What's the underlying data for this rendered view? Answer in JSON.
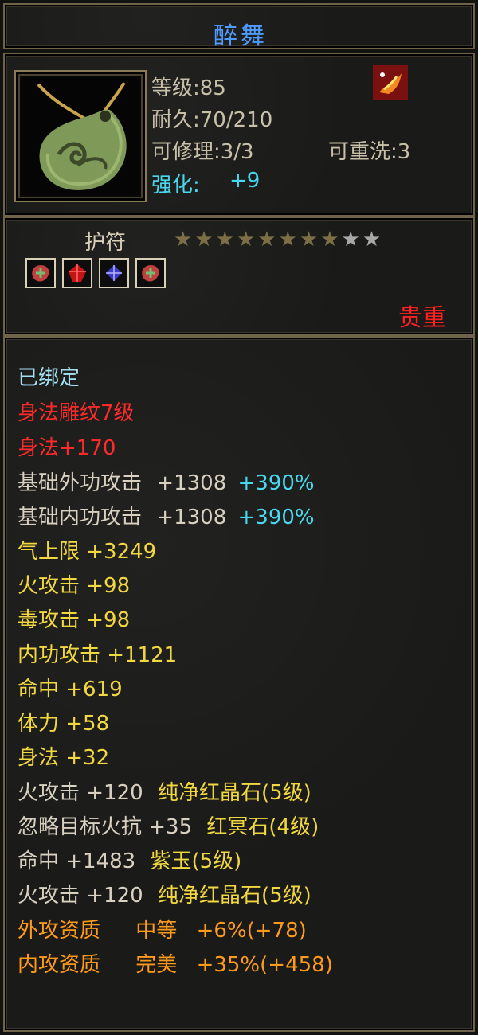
{
  "item": {
    "name": "醉舞",
    "level_label": "等级:85",
    "durability_label": "耐久:70/210",
    "repair_label": "可修理:3/3",
    "rewash_label": "可重洗:3",
    "enhance_prefix": "强化:",
    "enhance_value": "+9",
    "type": "护符",
    "stars_filled": 8,
    "stars_total": 10,
    "rarity": "贵重",
    "gems": [
      "green-gem",
      "red-gem",
      "blue-gem",
      "green-gem"
    ],
    "icon": "jade-pendant-icon",
    "badge_icon": "phoenix-badge-icon"
  },
  "stats": {
    "bound": "已绑定",
    "engrave": "身法雕纹7级",
    "engrave_bonus": "身法+170",
    "base_outer_attack": {
      "label": "基础外功攻击",
      "value": "+1308",
      "pct": "+390%"
    },
    "base_inner_attack": {
      "label": "基础内功攻击",
      "value": "+1308",
      "pct": "+390%"
    },
    "qi_limit": "气上限 +3249",
    "fire_attack": "火攻击 +98",
    "poison_attack": "毒攻击 +98",
    "inner_attack": "内功攻击 +1121",
    "hit": "命中 +619",
    "stamina": "体力 +58",
    "agility": "身法 +32",
    "gem1": {
      "stat": "火攻击 +120",
      "gem": "纯净红晶石(5级)"
    },
    "gem2": {
      "stat": "忽略目标火抗 +35",
      "gem": "红冥石(4级)"
    },
    "gem3": {
      "stat": "命中 +1483",
      "gem": "紫玉(5级)"
    },
    "gem4": {
      "stat": "火攻击 +120",
      "gem": "纯净红晶石(5级)"
    },
    "outer_aptitude": {
      "label": "外攻资质",
      "grade": "中等",
      "bonus": "+6%(+78)"
    },
    "inner_aptitude": {
      "label": "内攻资质",
      "grade": "完美",
      "bonus": "+35%(+458)"
    }
  },
  "colors": {
    "title": "#4f9bff",
    "cyan": "#48d8ee",
    "red": "#ff2a2a",
    "yellow": "#f2d840",
    "orange": "#ff9a1a"
  }
}
